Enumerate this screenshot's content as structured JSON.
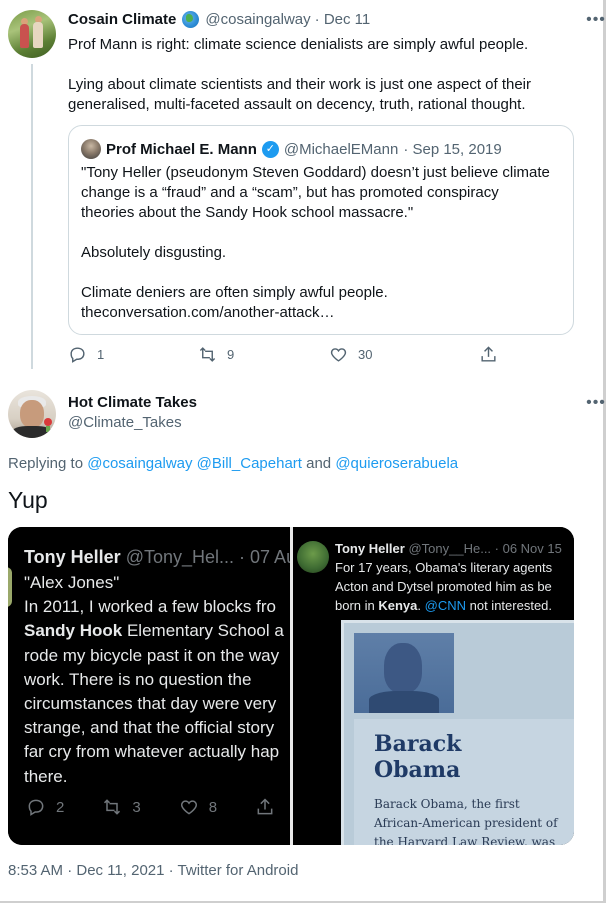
{
  "tweet1": {
    "name": "Cosain Climate",
    "handle": "@cosaingalway",
    "date": "· Dec 11",
    "line1": "Prof Mann is right: climate science denialists are simply awful people.",
    "line2": "Lying about climate scientists and their work is just one aspect of their",
    "line3": "generalised, multi-faceted assault on decency, truth, rational thought.",
    "quote": {
      "name": "Prof Michael E. Mann",
      "handle": "@MichaelEMann",
      "date": "· Sep 15, 2019",
      "l1": "\"Tony Heller (pseudonym Steven Goddard) doesn’t just believe climate",
      "l2": "change is a “fraud” and a “scam”, but has promoted conspiracy",
      "l3": "theories about the Sandy Hook school massacre.\"",
      "l4": "Absolutely disgusting.",
      "l5": "Climate deniers are often simply awful people.",
      "l6": "theconversation.com/another-attack…"
    },
    "actions": {
      "replies": "1",
      "retweets": "9",
      "likes": "30"
    }
  },
  "main": {
    "name": "Hot Climate Takes",
    "handle": "@Climate_Takes",
    "replying_prefix": "Replying to",
    "replying_users": "@cosaingalway @Bill_Capehart",
    "replying_and": "and",
    "replying_last": "@quieroserabuela",
    "text": "Yup",
    "footer": "8:53 AM · Dec 11, 2021 · Twitter for Android"
  },
  "media": {
    "left": {
      "name": "Tony Heller",
      "handle_date": "@Tony_Hel... · 07 Au",
      "l1": "\"Alex Jones\"",
      "l2": "In 2011, I worked a few blocks fro",
      "l3_bold": "Sandy Hook",
      "l3_rest": " Elementary School a",
      "l4": "rode my bicycle past it on the way",
      "l5": "work. There is no question the",
      "l6": "circumstances that day were very",
      "l7": "strange, and that the official story",
      "l8": "far cry from whatever actually hap",
      "l9": "there.",
      "replies": "2",
      "retweets": "3",
      "likes": "8"
    },
    "right": {
      "name": "Tony Heller",
      "handle_date": "@Tony__He... · 06 Nov 15",
      "l1": "For 17 years, Obama's literary agents",
      "l2": "Acton and Dytsel promoted him as be",
      "l3_pre": "born in ",
      "l3_bold": "Kenya",
      "l3_mid": ". ",
      "l3_link": "@CNN",
      "l3_rest": " not interested.",
      "book_first": "Barack",
      "book_last": "Obama",
      "book_d1": "Barack Obama, the first",
      "book_d2": "African-American president of",
      "book_d3": "the Harvard Law Review, was"
    }
  },
  "colors": {
    "link": "#1d9bf0",
    "text": "#0f1419",
    "muted": "#536471",
    "verified": "#1d9bf0"
  }
}
